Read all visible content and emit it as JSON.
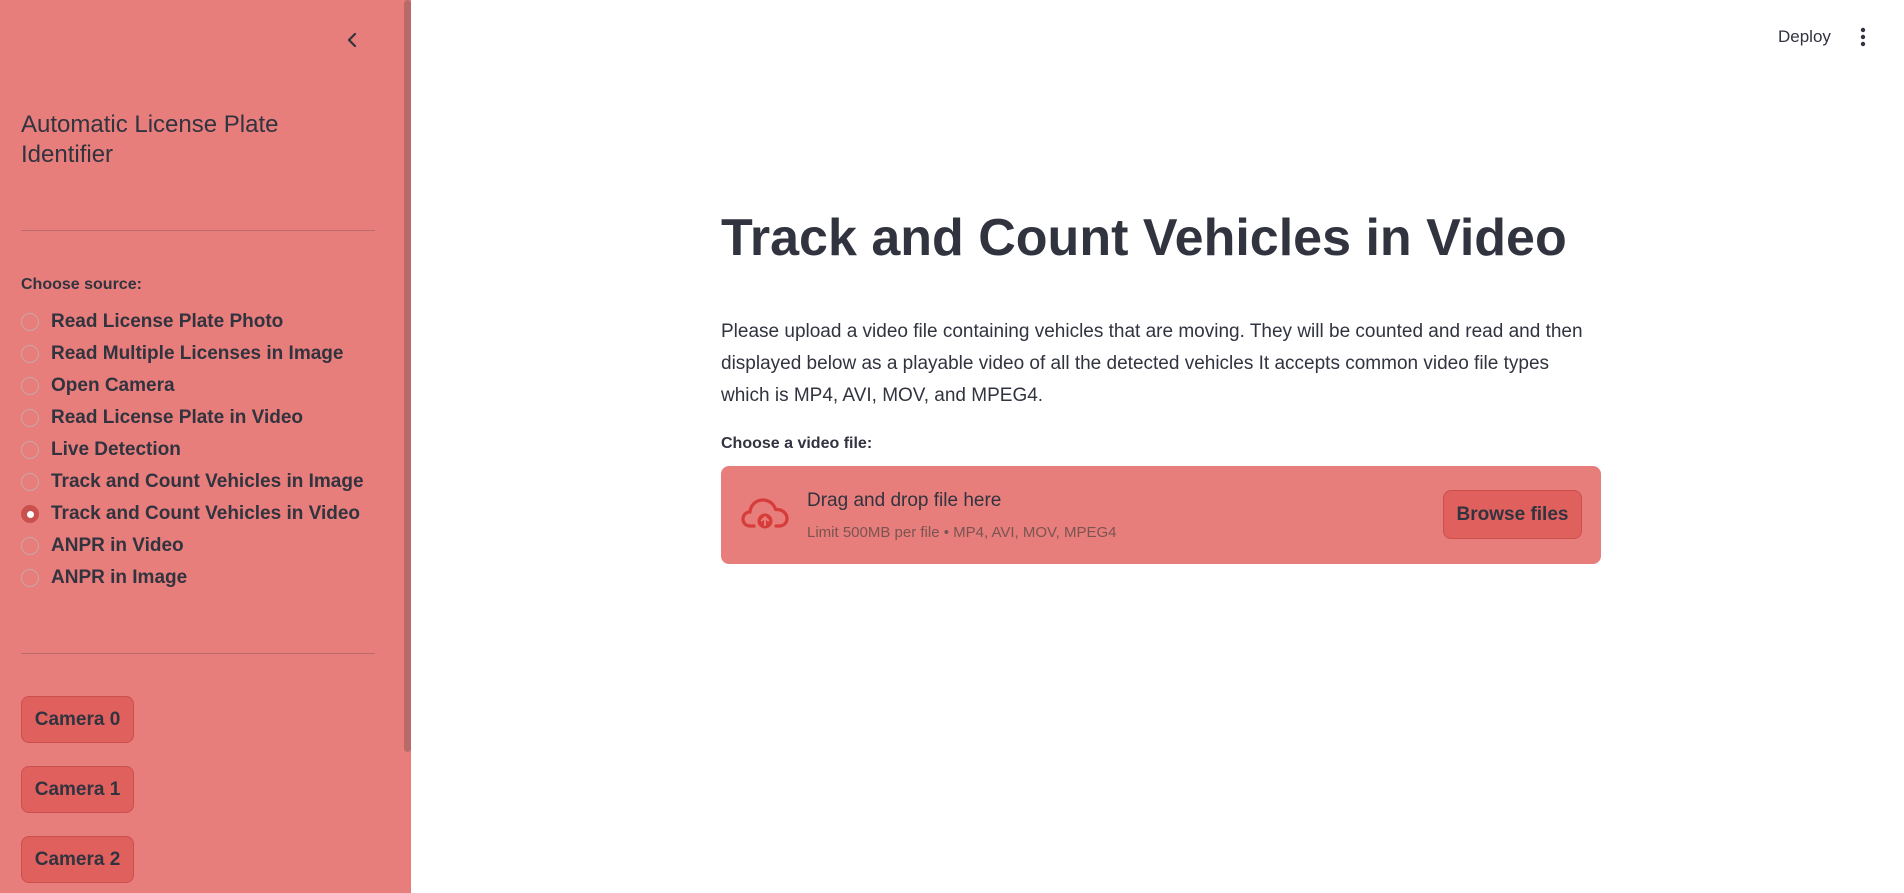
{
  "sidebar": {
    "app_title": "Automatic License Plate Identifier",
    "collapse_icon": "chevron-left-icon",
    "source_label": "Choose source:",
    "sources": [
      {
        "label": "Read License Plate Photo",
        "selected": false
      },
      {
        "label": "Read Multiple Licenses in Image",
        "selected": false
      },
      {
        "label": "Open Camera",
        "selected": false
      },
      {
        "label": "Read License Plate in Video",
        "selected": false
      },
      {
        "label": "Live Detection",
        "selected": false
      },
      {
        "label": "Track and Count Vehicles in Image",
        "selected": false
      },
      {
        "label": "Track and Count Vehicles in Video",
        "selected": true
      },
      {
        "label": "ANPR in Video",
        "selected": false
      },
      {
        "label": "ANPR in Image",
        "selected": false
      }
    ],
    "camera_buttons": [
      "Camera 0",
      "Camera 1",
      "Camera 2"
    ]
  },
  "header": {
    "deploy_label": "Deploy",
    "menu_icon": "vertical-dots-icon"
  },
  "main": {
    "title": "Track and Count Vehicles in Video",
    "description": "Please upload a video file containing vehicles that are moving. They will be counted and read and then displayed below as a playable video of all the detected vehicles It accepts common video file types which is MP4, AVI, MOV, and MPEG4.",
    "uploader": {
      "label": "Choose a video file:",
      "icon": "cloud-upload-icon",
      "drop_text": "Drag and drop file here",
      "limit_text": "Limit 500MB per file • MP4, AVI, MOV, MPEG4",
      "browse_label": "Browse files"
    }
  },
  "colors": {
    "sidebar_bg": "#e87e7b",
    "button_bg": "#e0605e",
    "accent": "#c9504d",
    "text": "#31333f"
  }
}
